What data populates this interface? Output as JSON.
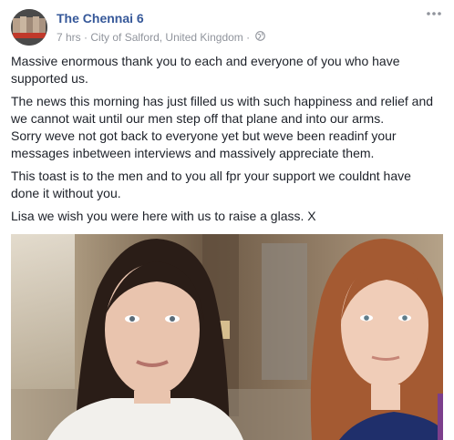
{
  "post": {
    "page_name": "The Chennai 6",
    "time": "7 hrs",
    "separator": "·",
    "location": "City of Salford, United Kingdom",
    "location_separator": "·",
    "more_icon": "ellipsis-icon",
    "privacy_icon": "globe-icon",
    "paragraphs": [
      "Massive enormous thank you to each and everyone of you who have supported us.",
      "The news this morning has just filled us with such happiness and relief and we cannot wait until our men step off that plane and into our arms.",
      "Sorry weve not got back to everyone yet but weve been readinf your messages inbetween interviews and massively appreciate them.",
      "This toast is to the men and to you all fpr your support we couldnt have done it without you.",
      "Lisa we wish you were here with us to raise a glass. X"
    ]
  },
  "colors": {
    "link": "#365899",
    "meta": "#90949c",
    "text": "#1d2129"
  }
}
